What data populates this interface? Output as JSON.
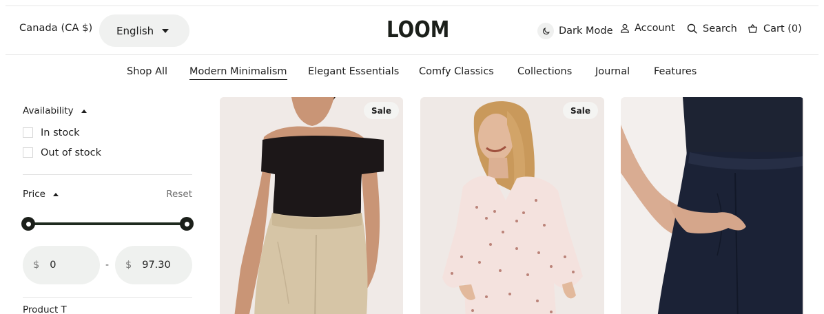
{
  "header": {
    "country": "Canada (CA $)",
    "language": "English",
    "logo": "LOOM",
    "dark_mode_label": "Dark Mode",
    "account_label": "Account",
    "search_label": "Search",
    "cart_label": "Cart (0)"
  },
  "nav": {
    "items": [
      "Shop All",
      "Modern Minimalism",
      "Elegant Essentials",
      "Comfy Classics",
      "Collections",
      "Journal",
      "Features"
    ],
    "active": "Modern Minimalism"
  },
  "filters": {
    "availability": {
      "title": "Availability",
      "options": [
        "In stock",
        "Out of stock"
      ]
    },
    "price": {
      "title": "Price",
      "reset_label": "Reset",
      "currency": "$",
      "min": "0",
      "max": "97.30",
      "separator": "-"
    },
    "next_section_partial": "Product T"
  },
  "products": [
    {
      "badge": "Sale",
      "image": "woman-black-off-shoulder-top-beige-trousers"
    },
    {
      "badge": "Sale",
      "image": "woman-printed-flutter-sleeve-dress"
    },
    {
      "badge": "",
      "image": "navy-wide-leg-pants"
    }
  ],
  "colors": {
    "accent": "#1b1f1a",
    "pill_bg": "#f0f1f0",
    "image_bg": "#f1ebe6"
  }
}
